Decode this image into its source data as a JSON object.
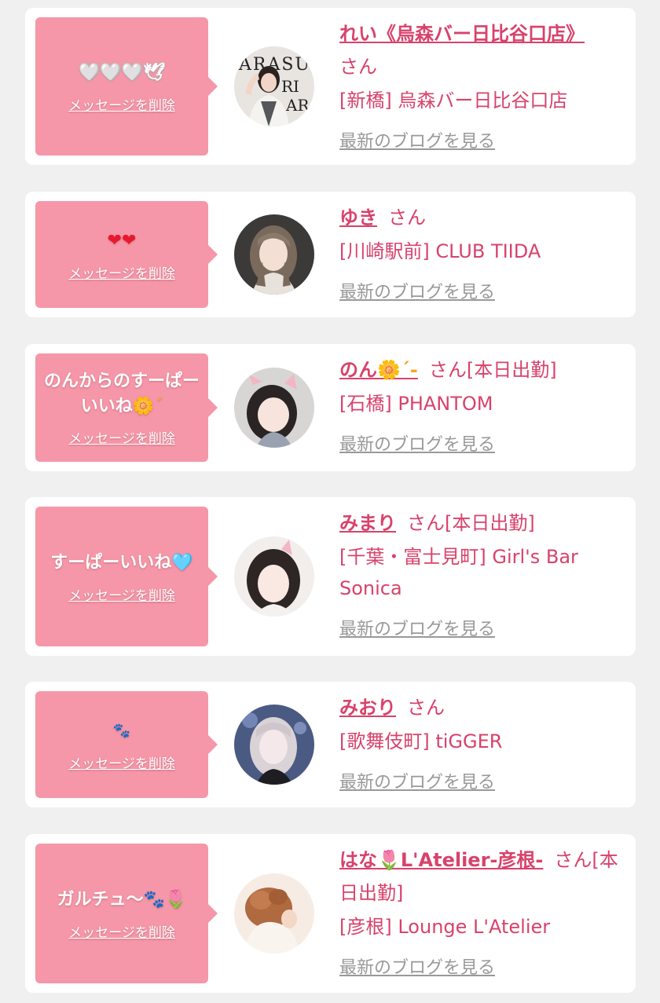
{
  "delete_label": "メッセージを削除",
  "blog_label": "最新のブログを見る",
  "cards": [
    {
      "message_text": "",
      "message_icons": "🤍🤍🤍🕊",
      "name": "れい《烏森バー日比谷口店》",
      "suffix": "さん",
      "shop": "[新橋] 烏森バー日比谷口店"
    },
    {
      "message_text": "",
      "message_icons": "❤❤",
      "name": "ゆき",
      "suffix": "さん",
      "shop": "[川崎駅前] CLUB TIIDA"
    },
    {
      "message_text": "のんからのすーぱーいいね",
      "message_icons": "🌼´",
      "name": "のん",
      "name_icons": "🌼´-",
      "suffix": "さん[本日出勤]",
      "shop": "[石橋] PHANTOM"
    },
    {
      "message_text": "すーぱーいいね",
      "message_icons": "🩵",
      "name": "みまり",
      "suffix": "さん[本日出勤]",
      "shop": "[千葉・富士見町] Girl's Bar Sonica"
    },
    {
      "message_text": "",
      "message_icons": "🐾",
      "name": "みおり",
      "suffix": "さん",
      "shop": "[歌舞伎町] tiGGER"
    },
    {
      "message_text": "ガルチュ〜",
      "message_icons": "🐾🌷",
      "name": "はな",
      "name_icons": "🌷",
      "name_rest": "L'Atelier-彦根-",
      "suffix": "さん[本日出勤]",
      "shop": "[彦根] Lounge L'Atelier"
    }
  ],
  "colors": {
    "page_bg": "#f0f0f0",
    "bubble": "#f597a8",
    "accent": "#d8426b",
    "link_gray": "#999999"
  }
}
